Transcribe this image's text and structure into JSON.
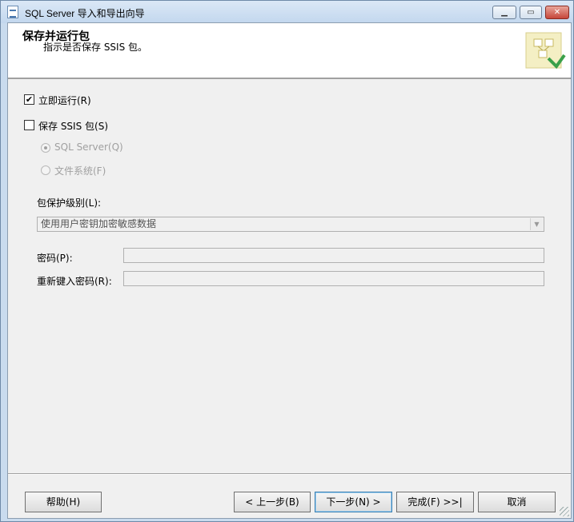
{
  "window": {
    "title": "SQL Server 导入和导出向导",
    "min_glyph": "▁",
    "max_glyph": "▭",
    "close_glyph": "✕"
  },
  "header": {
    "title": "保存并运行包",
    "subtitle": "指示是否保存 SSIS 包。",
    "graphic_icon": "wizard-package-icon"
  },
  "options": {
    "run_immediately": {
      "label": "立即运行(R)",
      "checked": true
    },
    "save_ssis": {
      "label": "保存 SSIS 包(S)",
      "checked": false
    },
    "sql_server": {
      "label": "SQL Server(Q)",
      "selected": true,
      "enabled": false
    },
    "file_system": {
      "label": "文件系统(F)",
      "selected": false,
      "enabled": false
    }
  },
  "protection": {
    "label": "包保护级别(L):",
    "value": "使用用户密钥加密敏感数据"
  },
  "password": {
    "label": "密码(P):",
    "value": ""
  },
  "confirm_password": {
    "label": "重新键入密码(R):",
    "value": ""
  },
  "buttons": {
    "help": "帮助(H)",
    "back": "< 上一步(B)",
    "next": "下一步(N) >",
    "finish": "完成(F) >>|",
    "cancel": "取消"
  },
  "colors": {
    "title_bar": "#c9dbee",
    "close_button": "#c6463a",
    "panel": "#f0f0f0",
    "disabled_text": "#a0a0a0"
  }
}
